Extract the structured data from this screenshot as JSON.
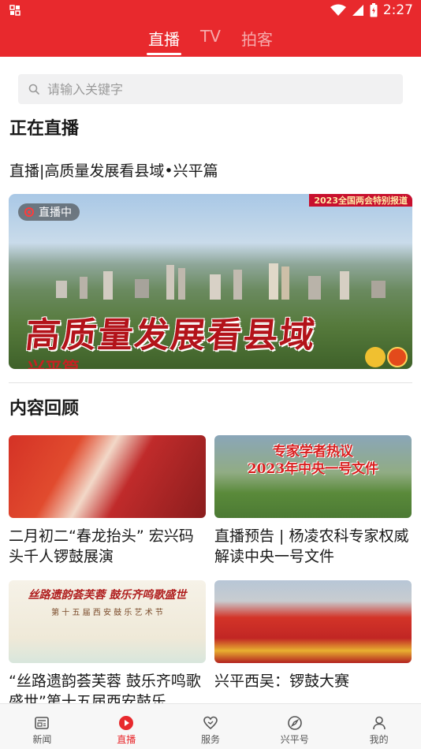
{
  "status_bar": {
    "time": "2:27"
  },
  "top_tabs": [
    {
      "label": "直播",
      "active": true
    },
    {
      "label": "TV",
      "active": false
    },
    {
      "label": "拍客",
      "active": false
    }
  ],
  "search": {
    "placeholder": "请输入关键字"
  },
  "live_section": {
    "title": "正在直播",
    "item_title": "直播|高质量发展看县域•兴平篇",
    "badge": "直播中",
    "banner_tag": "2023全国两会特别报道",
    "headline": "高质量发展看县域",
    "sub_headline": "兴平篇"
  },
  "review_section": {
    "title": "内容回顾",
    "items": [
      {
        "caption": "二月初二“春龙抬头” 宏兴码头千人锣鼓展演"
      },
      {
        "caption": "直播预告 | 杨凌农科专家权威解读中央一号文件",
        "thumb_text_1": "专家学者热议",
        "thumb_text_2": "2023年中央一号文件"
      },
      {
        "caption": "“丝路遗韵荟芙蓉 鼓乐齐鸣歌盛世”第十五届西安鼓乐...",
        "thumb_text_1": "丝路遗韵荟芙蓉  鼓乐齐鸣歌盛世",
        "thumb_text_2": "第 十 五 届 西 安 鼓 乐 艺 术 节"
      },
      {
        "caption": "兴平西吴：锣鼓大赛"
      }
    ]
  },
  "bottom_tabs": [
    {
      "label": "新闻",
      "icon": "news-icon",
      "active": false
    },
    {
      "label": "直播",
      "icon": "play-icon",
      "active": true
    },
    {
      "label": "服务",
      "icon": "service-icon",
      "active": false
    },
    {
      "label": "兴平号",
      "icon": "compass-icon",
      "active": false
    },
    {
      "label": "我的",
      "icon": "user-icon",
      "active": false
    }
  ],
  "colors": {
    "brand_red": "#e8292d",
    "inactive_gray": "#555555"
  }
}
